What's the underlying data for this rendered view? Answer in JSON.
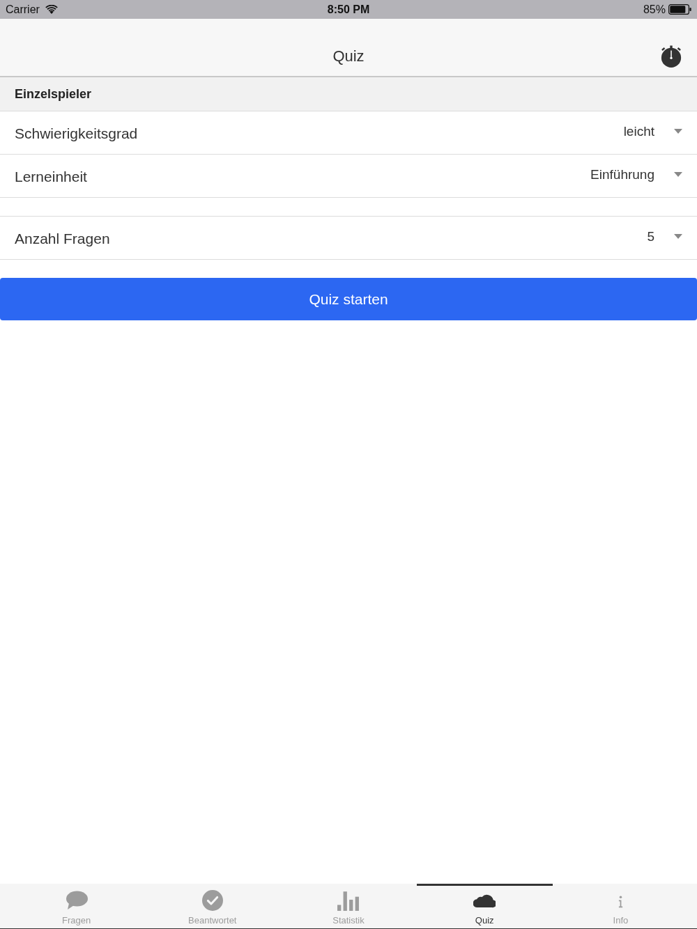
{
  "status_bar": {
    "carrier": "Carrier",
    "time": "8:50 PM",
    "battery": "85%"
  },
  "nav_bar": {
    "title": "Quiz"
  },
  "section": {
    "title": "Einzelspieler"
  },
  "groups": [
    {
      "rows": [
        {
          "label": "Schwierigkeitsgrad",
          "value": "leicht"
        },
        {
          "label": "Lerneinheit",
          "value": "Einführung"
        }
      ]
    },
    {
      "rows": [
        {
          "label": "Anzahl Fragen",
          "value": "5"
        }
      ]
    }
  ],
  "start_button": {
    "label": "Quiz starten"
  },
  "tabs": [
    {
      "label": "Fragen",
      "selected": false
    },
    {
      "label": "Beantwortet",
      "selected": false
    },
    {
      "label": "Statistik",
      "selected": false
    },
    {
      "label": "Quiz",
      "selected": true
    },
    {
      "label": "Info",
      "selected": false
    }
  ]
}
